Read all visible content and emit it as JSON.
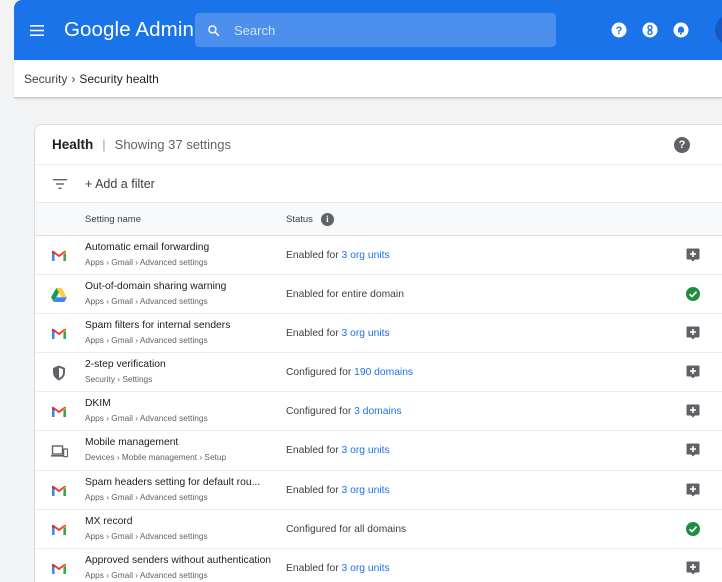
{
  "app": {
    "title_google": "Google",
    "title_admin": "Admin"
  },
  "search": {
    "placeholder": "Search"
  },
  "breadcrumb": {
    "parent": "Security",
    "separator": "›",
    "current": "Security health"
  },
  "card": {
    "title": "Health",
    "divider": "|",
    "count_text": "Showing 37 settings",
    "help": "?"
  },
  "filter": {
    "label": "+ Add a filter"
  },
  "columns": {
    "setting_name": "Setting name",
    "status": "Status",
    "info": "i"
  },
  "rows": [
    {
      "icon": "gmail-icon",
      "name": "Automatic email forwarding",
      "path": "Apps › Gmail › Advanced settings",
      "status_prefix": "Enabled for ",
      "status_link": "3 org units",
      "state": "warning"
    },
    {
      "icon": "google-drive-icon",
      "name": "Out-of-domain sharing warning",
      "path": "Apps › Gmail › Advanced settings",
      "status_prefix": "Enabled for entire domain",
      "status_link": "",
      "state": "ok"
    },
    {
      "icon": "gmail-icon",
      "name": "Spam filters for internal senders",
      "path": "Apps › Gmail › Advanced settings",
      "status_prefix": "Enabled for ",
      "status_link": "3 org units",
      "state": "warning"
    },
    {
      "icon": "shield-icon",
      "name": "2-step verification",
      "path": "Security › Settings",
      "status_prefix": "Configured for ",
      "status_link": "190 domains",
      "state": "warning"
    },
    {
      "icon": "gmail-icon",
      "name": "DKIM",
      "path": "Apps › Gmail › Advanced settings",
      "status_prefix": "Configured for ",
      "status_link": "3 domains",
      "state": "warning"
    },
    {
      "icon": "devices-icon",
      "name": "Mobile management",
      "path": "Devices › Mobile management › Setup",
      "status_prefix": "Enabled for ",
      "status_link": "3 org units",
      "state": "warning"
    },
    {
      "icon": "gmail-icon",
      "name": "Spam headers setting for default rou...",
      "path": "Apps › Gmail › Advanced settings",
      "status_prefix": "Enabled for ",
      "status_link": "3 org units",
      "state": "warning"
    },
    {
      "icon": "gmail-icon",
      "name": "MX record",
      "path": "Apps › Gmail › Advanced settings",
      "status_prefix": "Configured for all domains",
      "status_link": "",
      "state": "ok"
    },
    {
      "icon": "gmail-icon",
      "name": "Approved senders without authentication",
      "path": "Apps › Gmail › Advanced settings",
      "status_prefix": "Enabled for ",
      "status_link": "3 org units",
      "state": "warning"
    }
  ],
  "colors": {
    "brand_blue": "#1a73e8",
    "ok_green": "#1e8e3e",
    "warning_gray": "#5f6368",
    "link_blue": "#1a73e8"
  }
}
